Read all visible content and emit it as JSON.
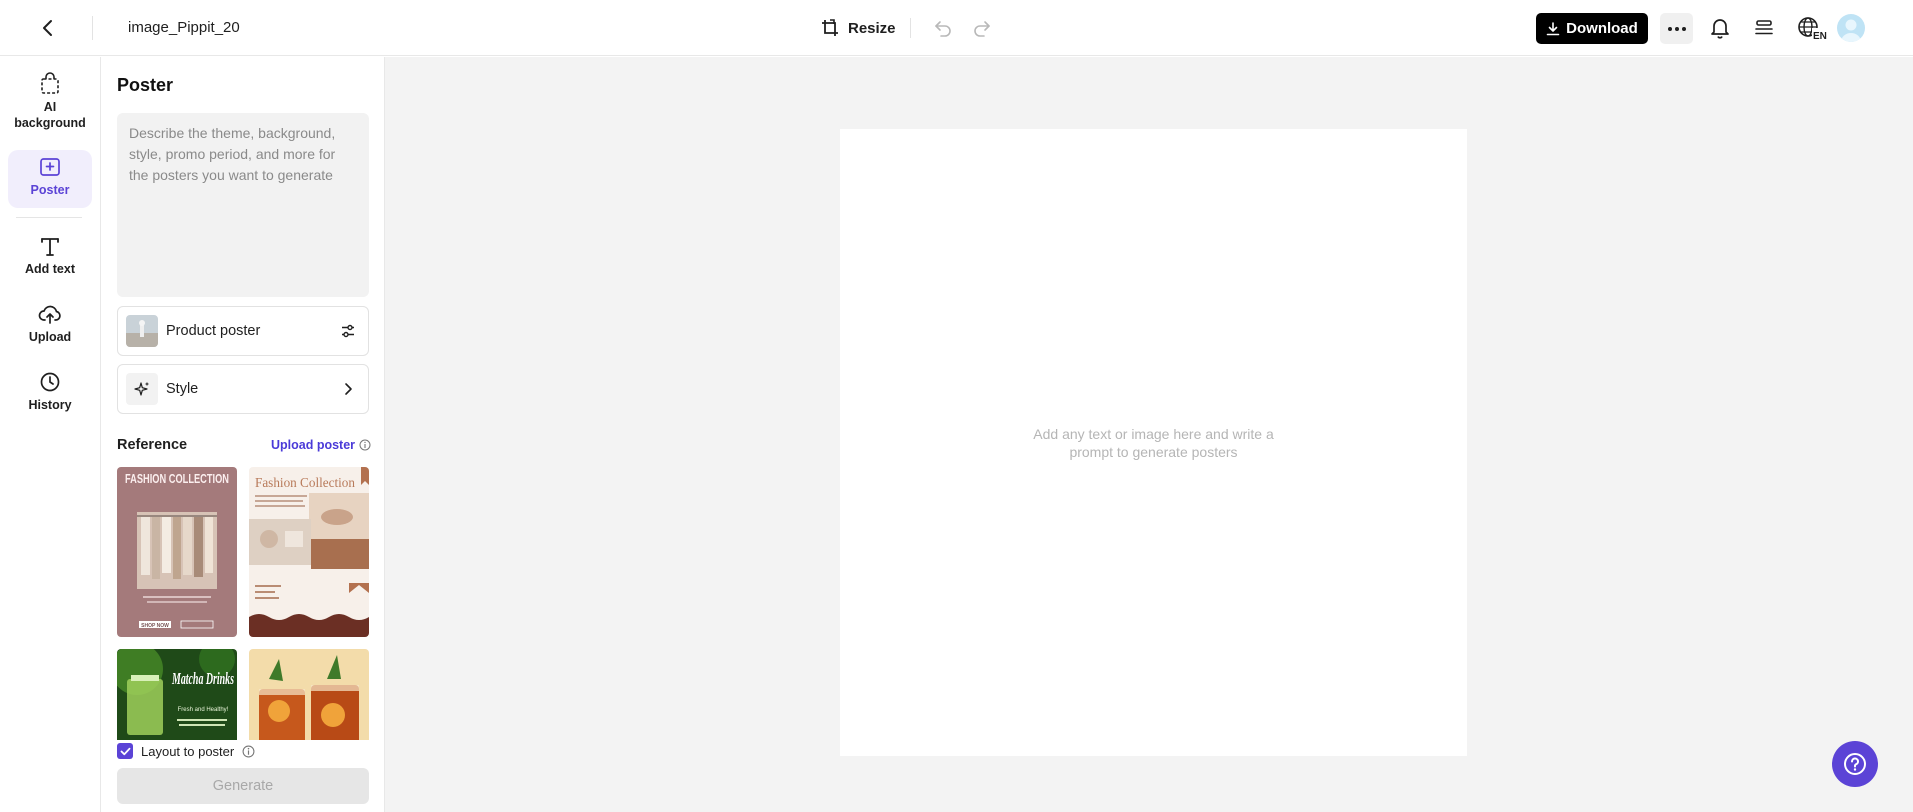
{
  "header": {
    "doc_title": "image_Pippit_20",
    "resize_label": "Resize",
    "download_label": "Download",
    "lang_code": "EN",
    "icons": [
      "chevron-left-icon",
      "resize-icon",
      "undo-icon",
      "redo-icon",
      "download-icon",
      "more-icon",
      "bell-icon",
      "layers-icon",
      "globe-icon"
    ]
  },
  "rail": {
    "items": [
      {
        "label": "AI background",
        "icon": "bag-icon",
        "active": false
      },
      {
        "label": "Poster",
        "icon": "poster-icon",
        "active": true
      },
      {
        "label": "Add text",
        "icon": "text-icon",
        "active": false
      },
      {
        "label": "Upload",
        "icon": "cloud-upload-icon",
        "active": false
      },
      {
        "label": "History",
        "icon": "clock-icon",
        "active": false
      }
    ]
  },
  "panel": {
    "title": "Poster",
    "prompt_placeholder": "Describe the theme, background, style, promo period, and more for the posters you want to generate",
    "product_poster_label": "Product poster",
    "style_label": "Style",
    "reference_title": "Reference",
    "upload_poster_label": "Upload poster",
    "thumb_texts": {
      "fashion_title": "FASHION COLLECTION",
      "fashion_button": "SHOP NOW",
      "collection_title": "Fashion Collection",
      "matcha_title": "Matcha Drinks",
      "matcha_subtitle": "Fresh and Healthy!"
    },
    "layout_label": "Layout to poster",
    "layout_checked": true,
    "generate_label": "Generate"
  },
  "canvas": {
    "hint": "Add any text or image here and write a prompt to generate posters"
  },
  "colors": {
    "accent": "#5b43d6",
    "link": "#4a3ad8",
    "canvas_bg": "#f3f3f3"
  }
}
